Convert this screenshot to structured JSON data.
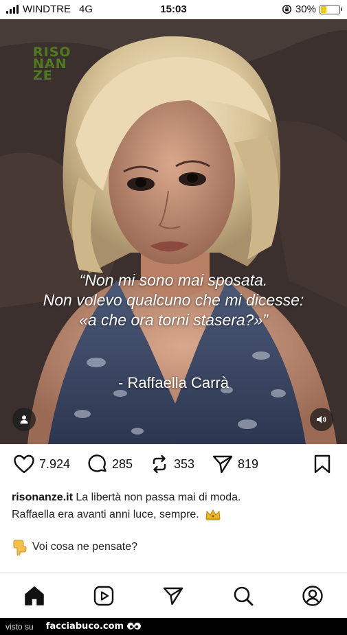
{
  "status_bar": {
    "carrier": "WINDTRE",
    "network": "4G",
    "time": "15:03",
    "battery": "30%",
    "battery_level": 0.3,
    "battery_color": "#f2c80f"
  },
  "post": {
    "watermark": "RISO NAN ZE",
    "quote_lines": [
      "“Non mi sono mai sposata.",
      "Non volevo qualcuno che mi dicesse:",
      "«a che ora torni stasera?»”"
    ],
    "author": "- Raffaella Carrà",
    "user_icon": "person-icon",
    "sound_icon": "speaker-icon"
  },
  "actions": {
    "likes": "7.924",
    "comments": "285",
    "reposts": "353",
    "shares": "819",
    "icons": [
      "heart-icon",
      "comment-icon",
      "repost-icon",
      "send-icon",
      "bookmark-icon"
    ]
  },
  "caption": {
    "username": "risonanze.it",
    "text_line1": "La libertà non passa mai di moda.",
    "text_line2": "Raffaella era avanti anni luce, sempre.",
    "question": "Voi cosa ne pensate?"
  },
  "bottom_nav": {
    "icons": [
      "home-icon",
      "reels-icon",
      "send-icon",
      "search-icon",
      "profile-icon"
    ]
  },
  "footer": {
    "visto_su": "visto su",
    "brand": "facciabuco.com"
  },
  "colors": {
    "watermark_green": "#4f7a1f",
    "text_dark": "#111111"
  }
}
